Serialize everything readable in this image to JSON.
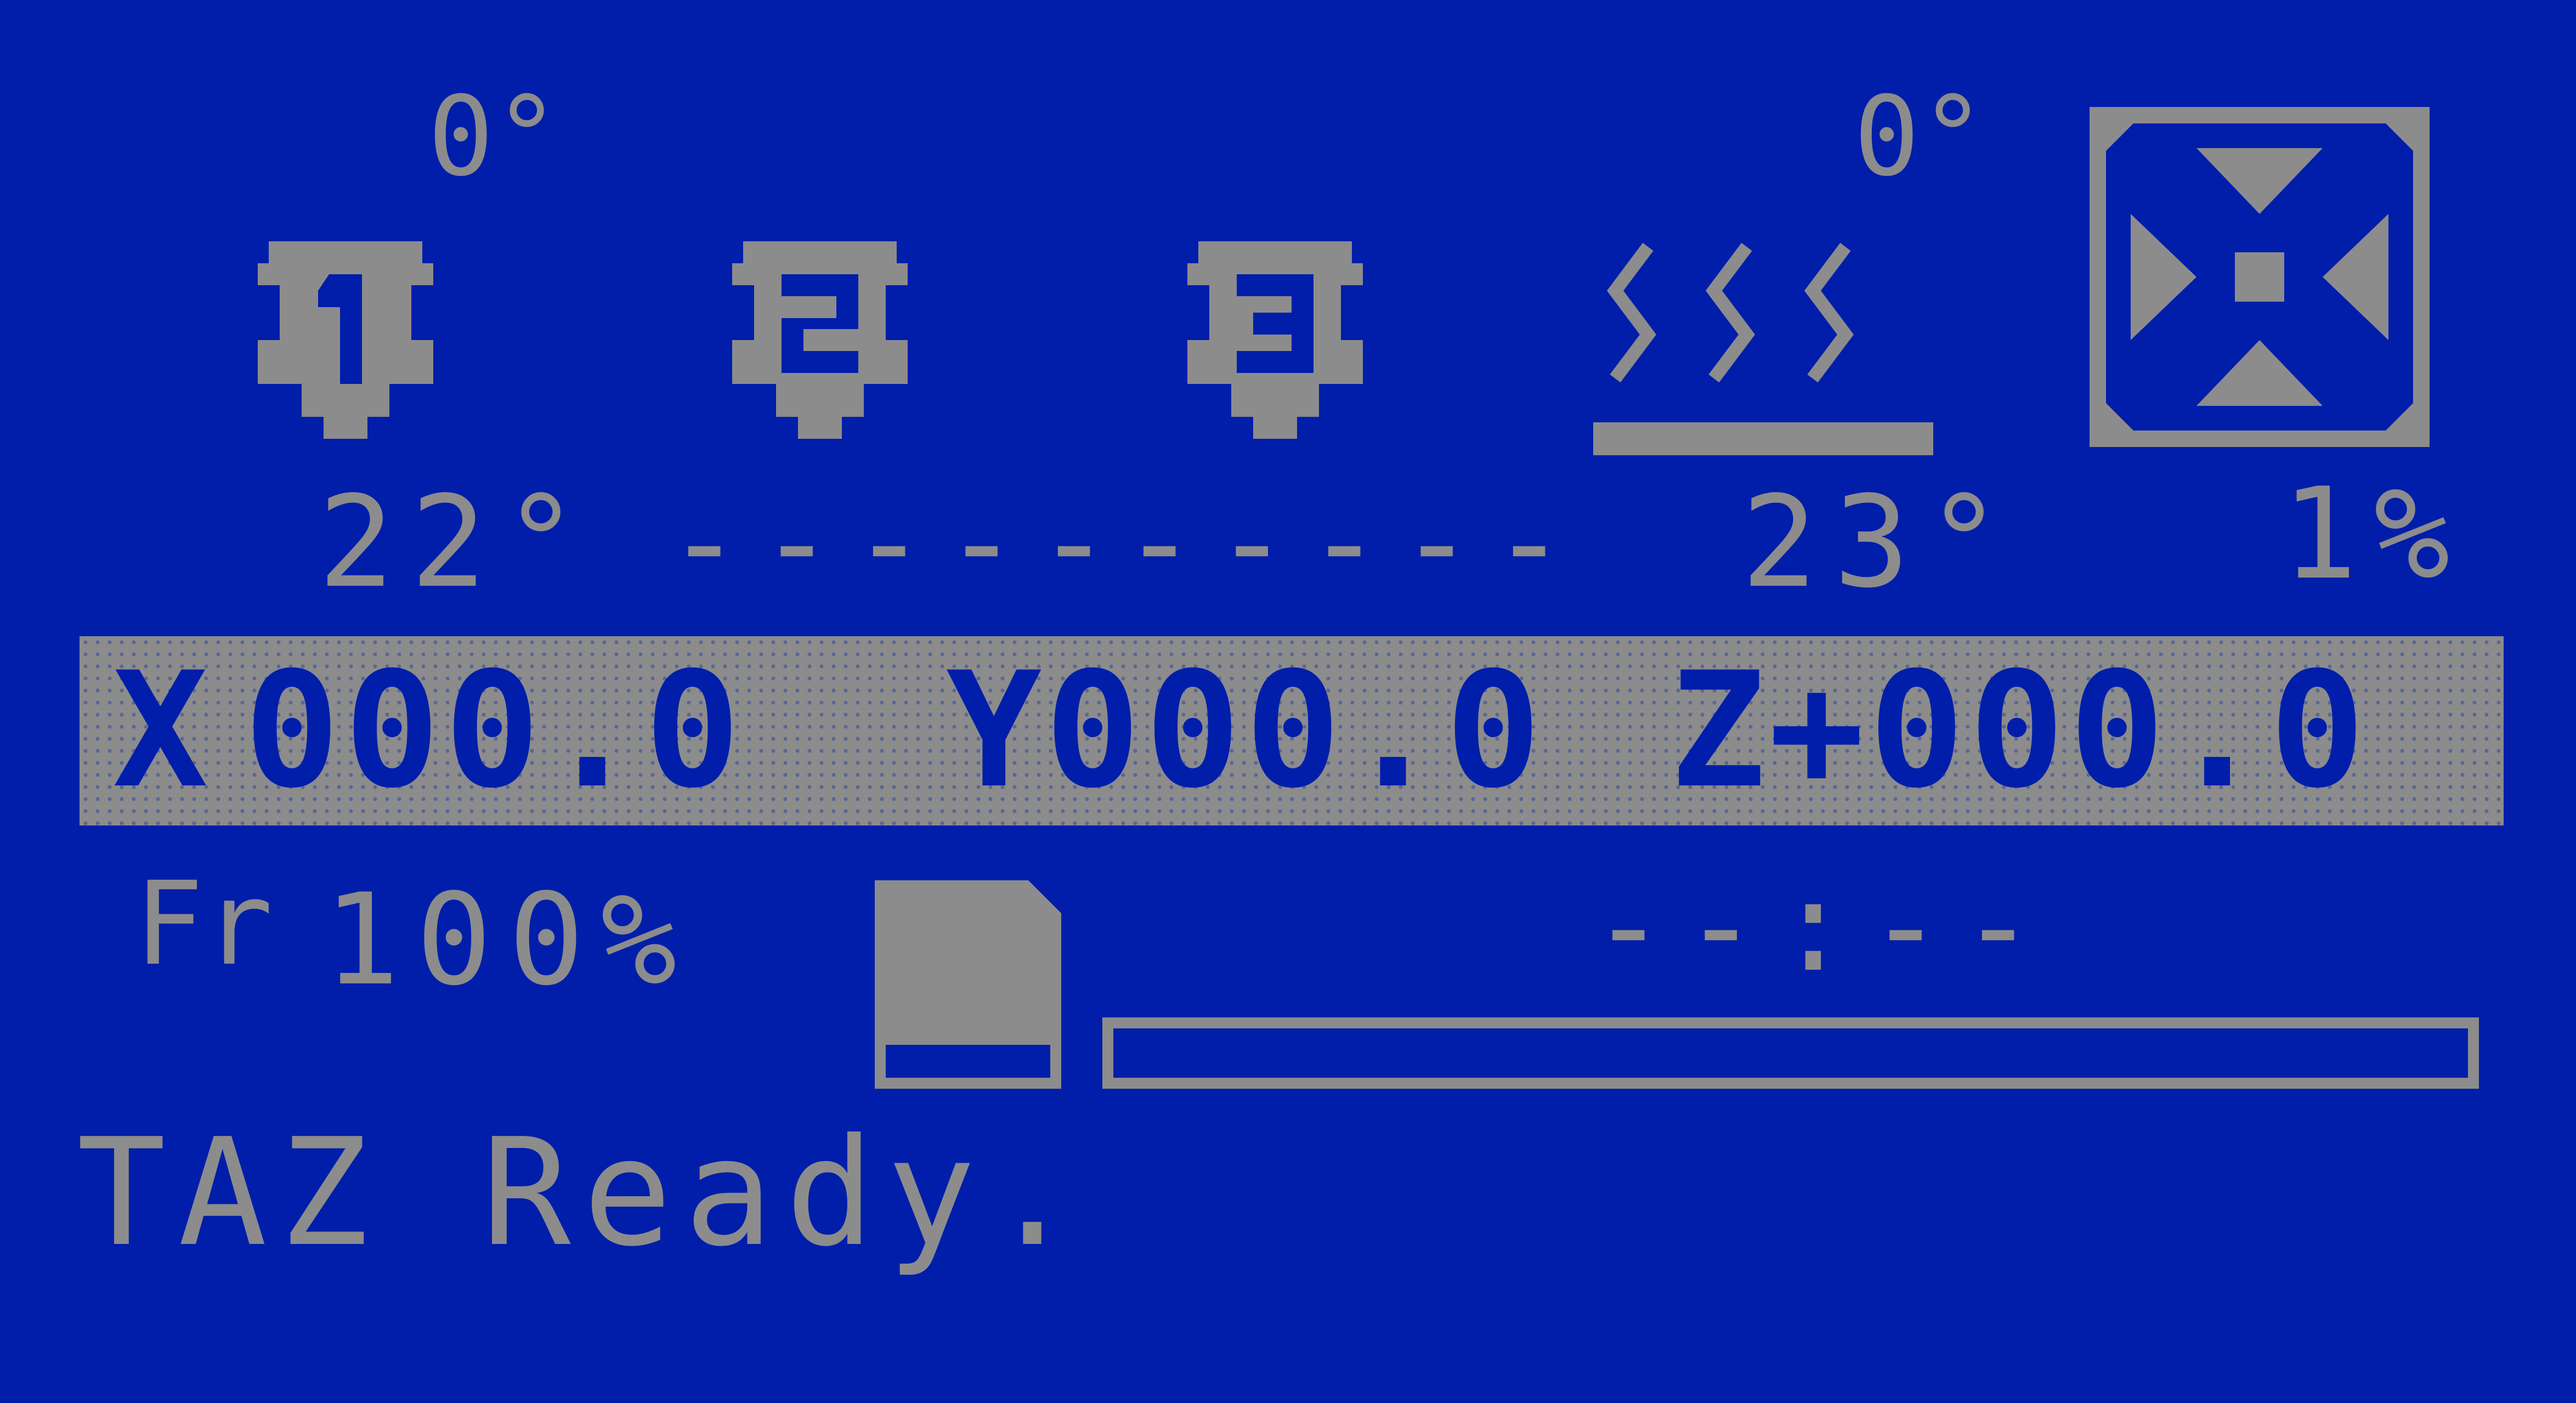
{
  "status_area": {
    "extruder1_target": "0°",
    "extruder1_temp": "22°",
    "extruder2_temp": "-----",
    "extruder3_temp": "-----",
    "bed_target": "0°",
    "bed_temp": "23°",
    "fan_percent": "1%"
  },
  "icons": {
    "extruder1": "hotend-1-icon",
    "extruder2": "hotend-2-icon",
    "extruder3": "hotend-3-icon",
    "bed": "heated-bed-icon",
    "fan": "fan-icon",
    "feedrate": "feedrate-icon",
    "sd": "sd-card-icon"
  },
  "position": {
    "x_label": "X",
    "x_value": "000.0",
    "y_label": "Y",
    "y_value": "000.0",
    "z_label": "Z",
    "z_value": "+000.0"
  },
  "feedrate": {
    "label": "Fr",
    "value": "100%"
  },
  "print_time": "--:--",
  "progress": {
    "value": 0
  },
  "status_message": "TAZ Ready."
}
